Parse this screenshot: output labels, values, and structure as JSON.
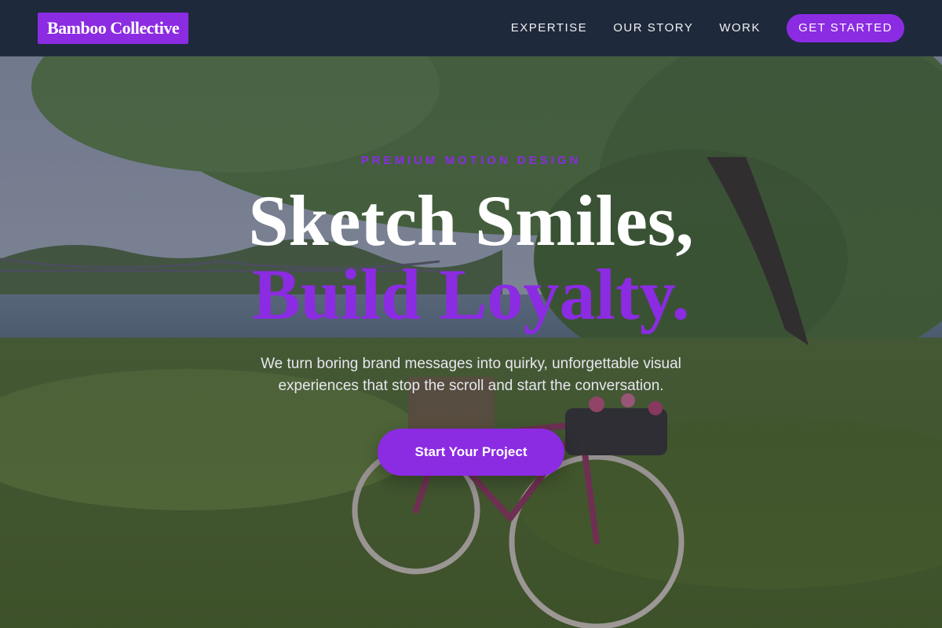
{
  "nav": {
    "logo": "Bamboo Collective",
    "links": [
      "EXPERTISE",
      "OUR STORY",
      "WORK"
    ],
    "cta": "GET STARTED"
  },
  "hero": {
    "eyebrow": "PREMIUM MOTION DESIGN",
    "headline_line1": "Sketch Smiles,",
    "headline_line2": "Build Loyalty.",
    "subtext": "We turn boring brand messages into quirky, unforgettable visual experiences that stop the scroll and start the conversation.",
    "cta": "Start Your Project"
  },
  "colors": {
    "accent": "#8b2be2",
    "nav_bg": "#1e293b",
    "text_light": "#ffffff"
  }
}
